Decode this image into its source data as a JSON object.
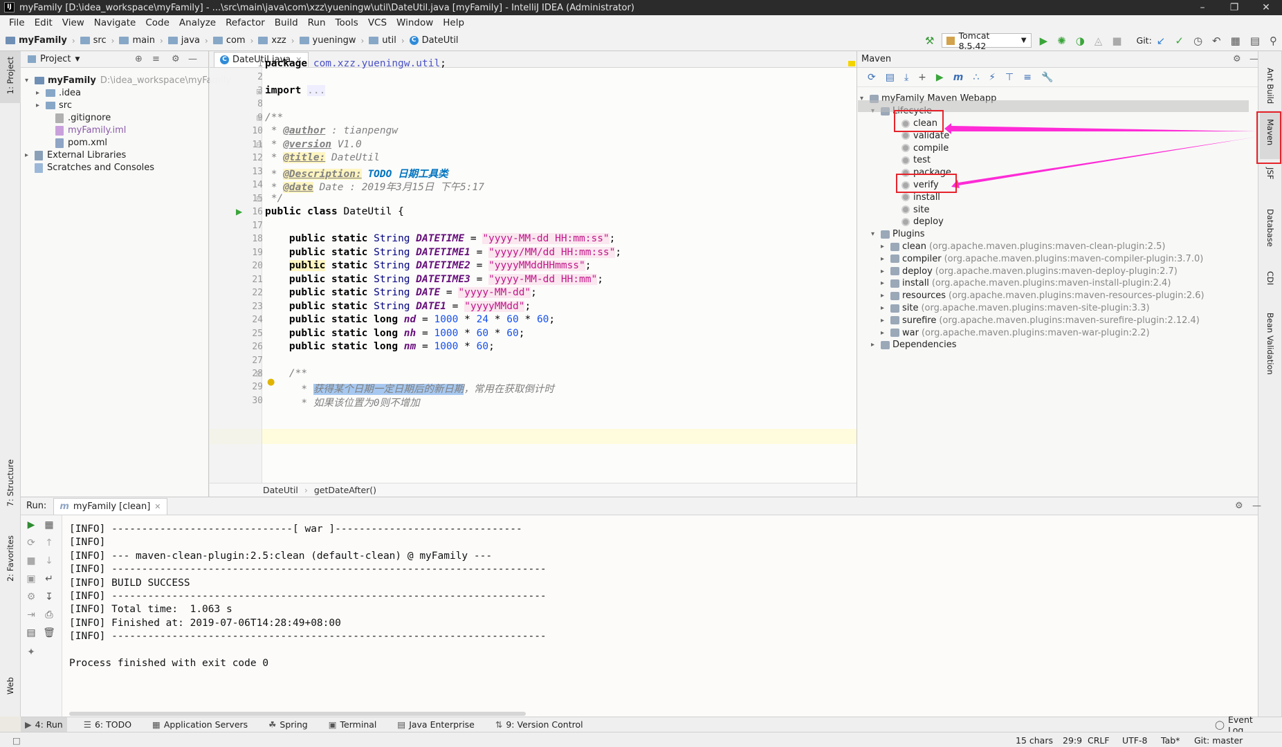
{
  "window": {
    "title": "myFamily [D:\\idea_workspace\\myFamily] - ...\\src\\main\\java\\com\\xzz\\yueningw\\util\\DateUtil.java [myFamily] - IntelliJ IDEA (Administrator)",
    "icon_letters": "IJ"
  },
  "menu": [
    "File",
    "Edit",
    "View",
    "Navigate",
    "Code",
    "Analyze",
    "Refactor",
    "Build",
    "Run",
    "Tools",
    "VCS",
    "Window",
    "Help"
  ],
  "breadcrumb": [
    "myFamily",
    "src",
    "main",
    "java",
    "com",
    "xzz",
    "yueningw",
    "util",
    "DateUtil"
  ],
  "toolbar": {
    "run_config": "Tomcat 8.5.42",
    "git_label": "Git:"
  },
  "left_strip": {
    "project": "1: Project",
    "structure": "7: Structure",
    "favorites": "2: Favorites",
    "web": "Web"
  },
  "right_strip": {
    "ant": "Ant Build",
    "maven": "Maven",
    "jsf": "JSF",
    "database": "Database",
    "cdi": "CDI",
    "bean": "Bean Validation"
  },
  "project": {
    "header": "Project",
    "root_name": "myFamily",
    "root_path": "D:\\idea_workspace\\myFamily",
    "items": [
      ".idea",
      "src",
      ".gitignore",
      "myFamily.iml",
      "pom.xml",
      "External Libraries",
      "Scratches and Consoles"
    ]
  },
  "editor": {
    "tab": "DateUtil.java",
    "line_numbers": [
      "1",
      "2",
      "3",
      "8",
      "9",
      "10",
      "11",
      "12",
      "13",
      "14",
      "15",
      "16",
      "17",
      "18",
      "19",
      "20",
      "21",
      "22",
      "23",
      "24",
      "25",
      "26",
      "27",
      "28",
      "29",
      "30"
    ],
    "breadcrumb": [
      "DateUtil",
      "getDateAfter()"
    ]
  },
  "maven": {
    "header": "Maven",
    "project": "myFamily Maven Webapp",
    "lifecycle_label": "Lifecycle",
    "lifecycle": [
      "clean",
      "validate",
      "compile",
      "test",
      "package",
      "verify",
      "install",
      "site",
      "deploy"
    ],
    "plugins_label": "Plugins",
    "plugins": [
      {
        "name": "clean",
        "detail": "(org.apache.maven.plugins:maven-clean-plugin:2.5)"
      },
      {
        "name": "compiler",
        "detail": "(org.apache.maven.plugins:maven-compiler-plugin:3.7.0)"
      },
      {
        "name": "deploy",
        "detail": "(org.apache.maven.plugins:maven-deploy-plugin:2.7)"
      },
      {
        "name": "install",
        "detail": "(org.apache.maven.plugins:maven-install-plugin:2.4)"
      },
      {
        "name": "resources",
        "detail": "(org.apache.maven.plugins:maven-resources-plugin:2.6)"
      },
      {
        "name": "site",
        "detail": "(org.apache.maven.plugins:maven-site-plugin:3.3)"
      },
      {
        "name": "surefire",
        "detail": "(org.apache.maven.plugins:maven-surefire-plugin:2.12.4)"
      },
      {
        "name": "war",
        "detail": "(org.apache.maven.plugins:maven-war-plugin:2.2)"
      }
    ],
    "dependencies_label": "Dependencies"
  },
  "run": {
    "label": "Run:",
    "tab": "myFamily [clean]",
    "lines": [
      "[INFO] ------------------------------[ war ]-------------------------------",
      "[INFO] ",
      "[INFO] --- maven-clean-plugin:2.5:clean (default-clean) @ myFamily ---",
      "[INFO] ------------------------------------------------------------------------",
      "[INFO] BUILD SUCCESS",
      "[INFO] ------------------------------------------------------------------------",
      "[INFO] Total time:  1.063 s",
      "[INFO] Finished at: 2019-07-06T14:28:49+08:00",
      "[INFO] ------------------------------------------------------------------------",
      "",
      "Process finished with exit code 0"
    ]
  },
  "tool_windows": [
    "4: Run",
    "6: TODO",
    "Application Servers",
    "Spring",
    "Terminal",
    "Java Enterprise",
    "9: Version Control",
    "Event Log"
  ],
  "status": {
    "chars": "15 chars",
    "position": "29:9",
    "line_sep": "CRLF",
    "encoding": "UTF-8",
    "indent": "Tab*",
    "git": "Git: master"
  },
  "colors": {
    "highlight_box": "#e6232a",
    "annotation_arrow": "#ff2bd6",
    "selection_bg": "#a6c8f0"
  }
}
